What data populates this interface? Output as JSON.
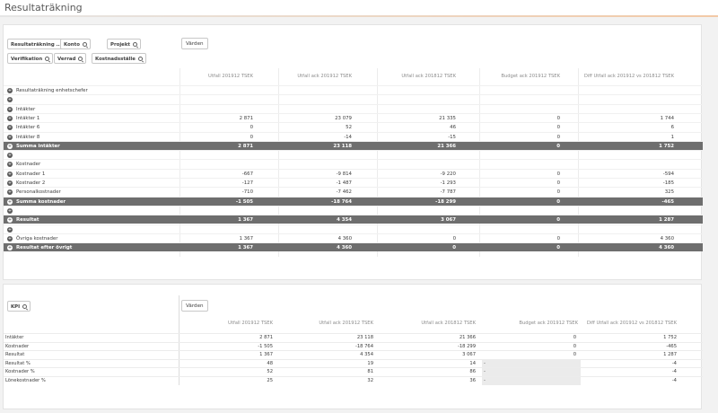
{
  "app": {
    "title": "Resultaträkning"
  },
  "panel1": {
    "filters": [
      {
        "label": "Resultaträkning ..."
      },
      {
        "label": "Konto"
      },
      {
        "label": "Projekt"
      },
      {
        "label": "Verifikation"
      },
      {
        "label": "Verrad"
      },
      {
        "label": "Kostnadsställe"
      }
    ],
    "values_button": "Värden",
    "columns": [
      "Utfall 201912 TSEK",
      "Utfall ack 201912 TSEK",
      "Utfall ack 201812 TSEK",
      "Budget ack 201912 TSEK",
      "Diff Utfall ack 201912 vs 201812 TSEK"
    ],
    "rows": [
      {
        "label": "Resultaträkning enhetschefer",
        "values": [
          "",
          "",
          "",
          "",
          ""
        ],
        "style": "normal"
      },
      {
        "label": "",
        "values": [
          "",
          "",
          "",
          "",
          ""
        ],
        "style": "normal"
      },
      {
        "label": "Intäkter",
        "values": [
          "",
          "",
          "",
          "",
          ""
        ],
        "style": "normal"
      },
      {
        "label": "Intäkter 1",
        "values": [
          "2 871",
          "23 079",
          "21 335",
          "0",
          "1 744"
        ],
        "style": "normal"
      },
      {
        "label": "Intäkter 6",
        "values": [
          "0",
          "52",
          "46",
          "0",
          "6"
        ],
        "style": "normal"
      },
      {
        "label": "Intäkter 8",
        "values": [
          "0",
          "-14",
          "-15",
          "0",
          "1"
        ],
        "style": "normal"
      },
      {
        "label": "Summa intäkter",
        "values": [
          "2 871",
          "23 118",
          "21 366",
          "0",
          "1 752"
        ],
        "style": "total"
      },
      {
        "label": "",
        "values": [
          "",
          "",
          "",
          "",
          ""
        ],
        "style": "normal"
      },
      {
        "label": "Kostnader",
        "values": [
          "",
          "",
          "",
          "",
          ""
        ],
        "style": "normal"
      },
      {
        "label": "Kostnader 1",
        "values": [
          "-667",
          "-9 814",
          "-9 220",
          "0",
          "-594"
        ],
        "style": "normal"
      },
      {
        "label": "Kostnader 2",
        "values": [
          "-127",
          "-1 487",
          "-1 293",
          "0",
          "-185"
        ],
        "style": "normal"
      },
      {
        "label": "Personalkostnader",
        "values": [
          "-710",
          "-7 462",
          "-7 787",
          "0",
          "325"
        ],
        "style": "normal"
      },
      {
        "label": "Summa kostnader",
        "values": [
          "-1 505",
          "-18 764",
          "-18 299",
          "0",
          "-465"
        ],
        "style": "total"
      },
      {
        "label": "",
        "values": [
          "",
          "",
          "",
          "",
          ""
        ],
        "style": "normal"
      },
      {
        "label": "Resultat",
        "values": [
          "1 367",
          "4 354",
          "3 067",
          "0",
          "1 287"
        ],
        "style": "total"
      },
      {
        "label": "",
        "values": [
          "",
          "",
          "",
          "",
          ""
        ],
        "style": "normal"
      },
      {
        "label": "Övriga kostnader",
        "values": [
          "1 367",
          "4 360",
          "0",
          "0",
          "4 360"
        ],
        "style": "normal"
      },
      {
        "label": "Resultat efter övrigt",
        "values": [
          "1 367",
          "4 360",
          "0",
          "0",
          "4 360"
        ],
        "style": "total"
      }
    ]
  },
  "panel2": {
    "filter": {
      "label": "KPI"
    },
    "values_button": "Värden",
    "columns": [
      "Utfall 201912 TSEK",
      "Utfall ack 201912 TSEK",
      "Utfall ack 201812 TSEK",
      "Budget ack 201912 TSEK",
      "Diff Utfall ack 201912 vs 201812 TSEK"
    ],
    "rows": [
      {
        "label": "Intäkter",
        "values": [
          "2 871",
          "23 118",
          "21 366",
          "0",
          "1 752"
        ],
        "grey": false
      },
      {
        "label": "Kostnader",
        "values": [
          "-1 505",
          "-18 764",
          "-18 299",
          "0",
          "-465"
        ],
        "grey": false
      },
      {
        "label": "Resultat",
        "values": [
          "1 367",
          "4 354",
          "3 067",
          "0",
          "1 287"
        ],
        "grey": false
      },
      {
        "label": "Resultat %",
        "values": [
          "48",
          "19",
          "14",
          "-",
          "-4"
        ],
        "grey": true
      },
      {
        "label": "Kostnader %",
        "values": [
          "52",
          "81",
          "86",
          "-",
          "-4"
        ],
        "grey": true
      },
      {
        "label": "Lönekostnader %",
        "values": [
          "25",
          "32",
          "36",
          "-",
          "-4"
        ],
        "grey": true
      }
    ]
  }
}
